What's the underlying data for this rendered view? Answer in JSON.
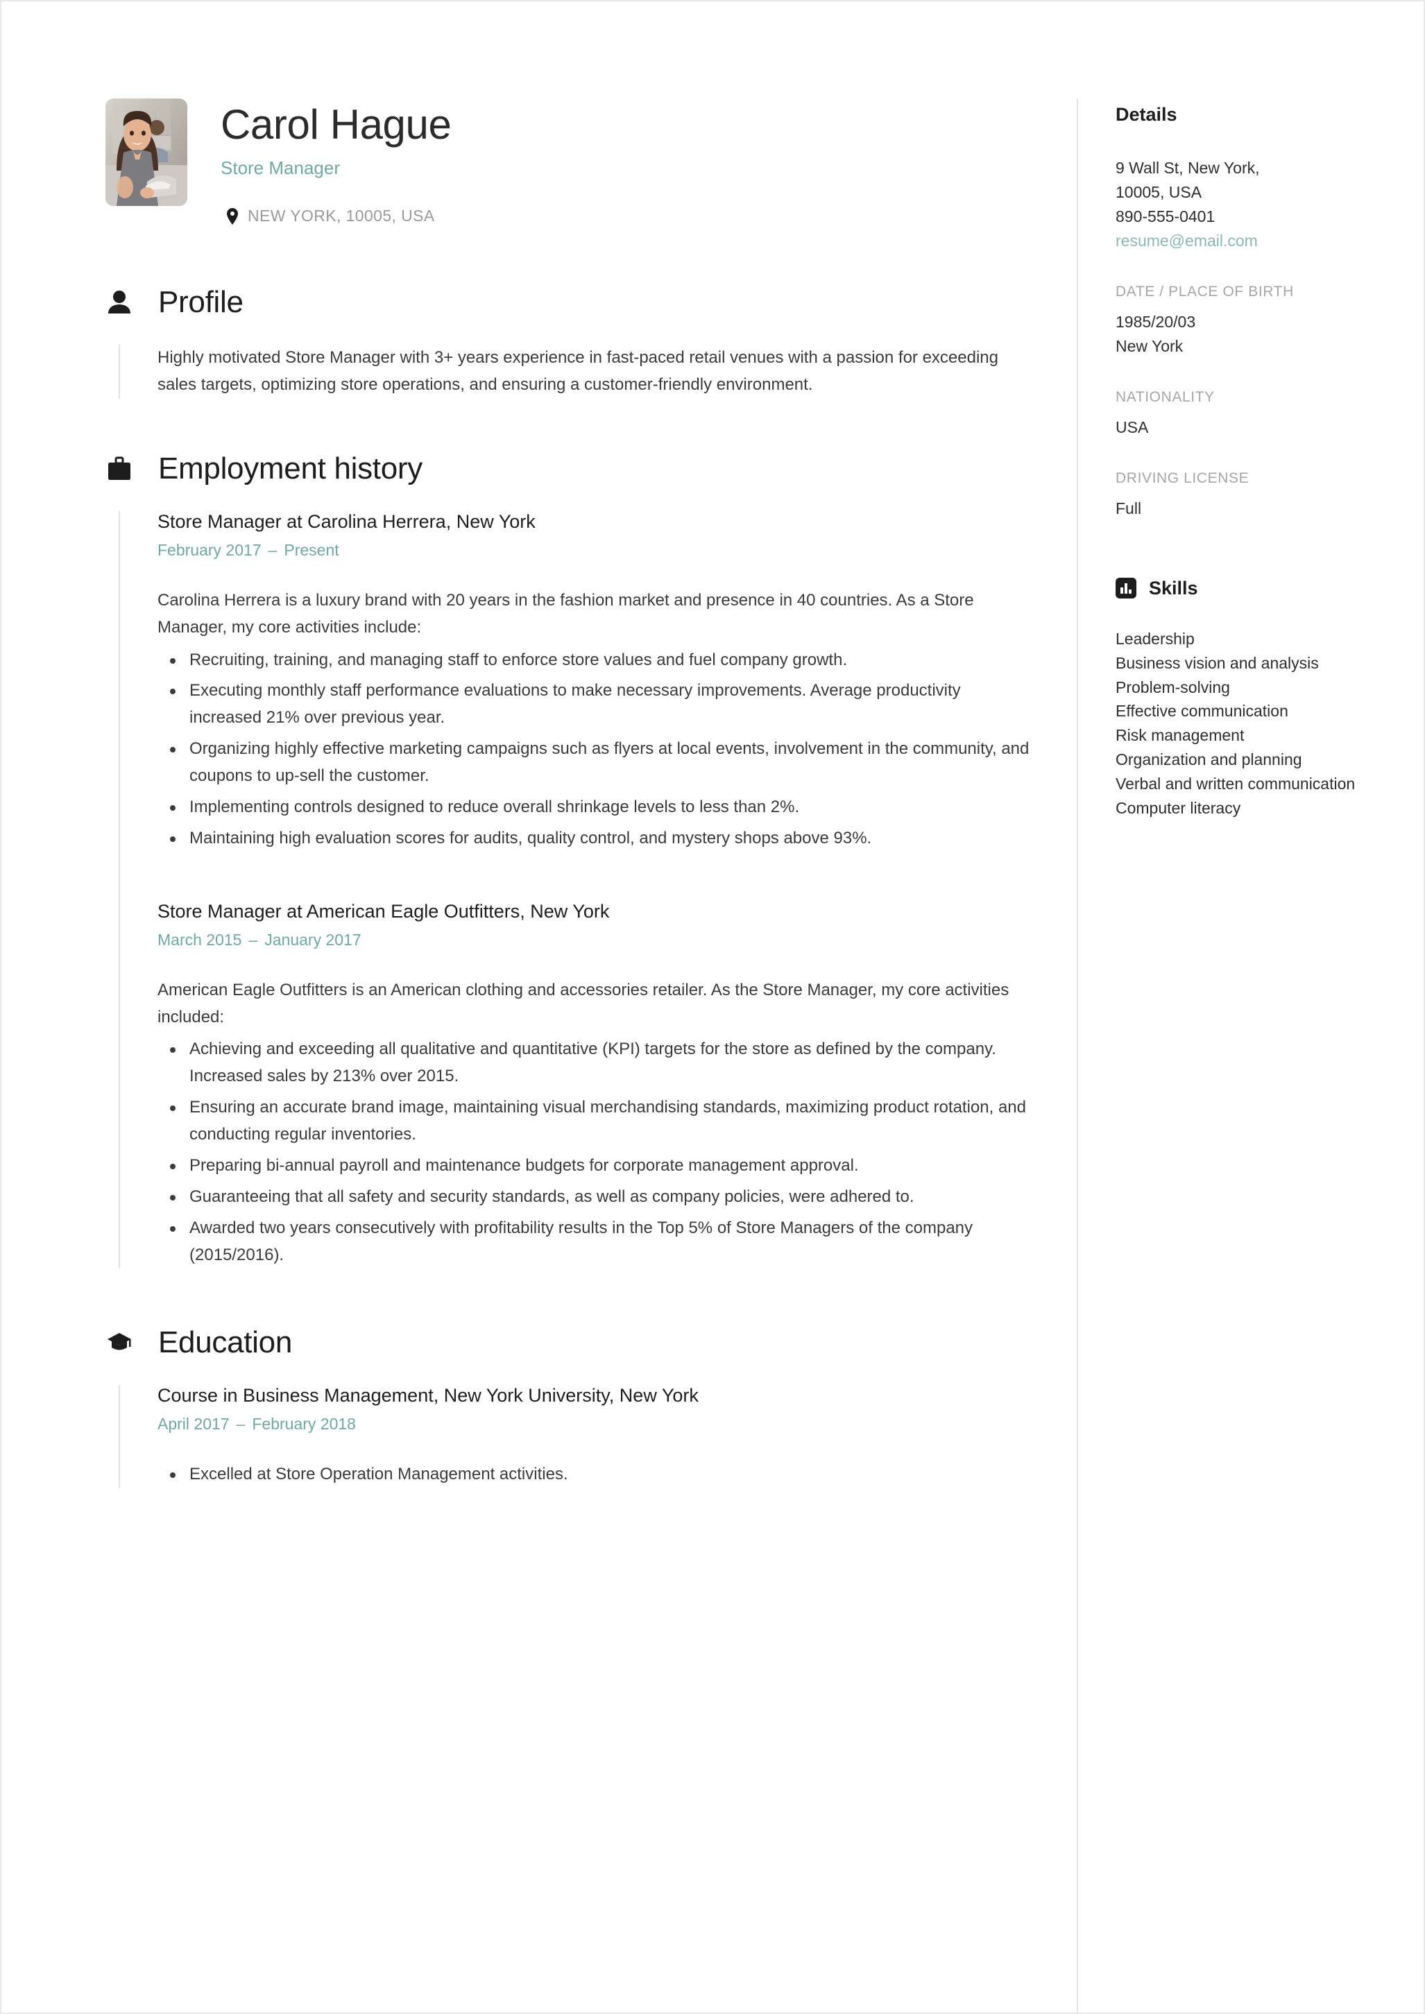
{
  "header": {
    "name": "Carol Hague",
    "role": "Store Manager",
    "location": "NEW YORK, 10005, USA",
    "location_icon": "map-pin-icon",
    "avatar_alt": "portrait-photo"
  },
  "accent_color": "#71a9a0",
  "label_color": "#a6a6a6",
  "text_color": "#3b3b3b",
  "sections": {
    "profile": {
      "icon": "person-icon",
      "title": "Profile",
      "text": "Highly motivated Store Manager with 3+ years experience in fast-paced retail venues with a passion for exceeding sales targets, optimizing store operations, and ensuring a customer-friendly environment."
    },
    "employment": {
      "icon": "briefcase-icon",
      "title": "Employment history",
      "entries": [
        {
          "title": "Store Manager at Carolina Herrera, New York",
          "date_start": "February 2017",
          "date_sep": "–",
          "date_end": "Present",
          "summary": "Carolina Herrera is a luxury brand with 20 years in the fashion market and presence in 40 countries. As a Store Manager, my core activities include:",
          "bullets": [
            "Recruiting, training, and managing staff to enforce store values and fuel company growth.",
            "Executing monthly staff performance evaluations to make necessary improvements. Average productivity increased 21% over previous year.",
            "Organizing highly effective marketing campaigns such as flyers at local events, involvement in the community, and coupons to up-sell the customer.",
            "Implementing controls designed to reduce overall shrinkage levels to less than 2%.",
            "Maintaining high evaluation scores for audits, quality control, and mystery shops above 93%."
          ]
        },
        {
          "title": "Store Manager at American Eagle Outfitters, New York",
          "date_start": "March 2015",
          "date_sep": "–",
          "date_end": "January 2017",
          "summary": "American Eagle Outfitters is an American clothing and accessories retailer. As the Store Manager, my core activities included:",
          "bullets": [
            "Achieving and exceeding all qualitative and quantitative (KPI) targets for the store as defined by the company. Increased sales by 213% over 2015.",
            "Ensuring an accurate brand image, maintaining visual merchandising standards, maximizing product rotation, and conducting regular inventories.",
            "Preparing bi-annual payroll and maintenance budgets for corporate management approval.",
            "Guaranteeing that all safety and security standards, as well as company policies, were adhered to.",
            "Awarded two years consecutively with profitability results in the Top 5% of Store Managers of the company (2015/2016)."
          ]
        }
      ]
    },
    "education": {
      "icon": "graduation-cap-icon",
      "title": "Education",
      "entries": [
        {
          "title": "Course in Business Management, New York University, New York",
          "date_start": "April 2017",
          "date_sep": "–",
          "date_end": "February 2018",
          "bullets": [
            "Excelled at Store Operation Management activities."
          ]
        }
      ]
    }
  },
  "sidebar": {
    "details_heading": "Details",
    "address_line1": "9 Wall St, New York,",
    "address_line2": "10005, USA",
    "phone": "890-555-0401",
    "email": "resume@email.com",
    "dob_label": "DATE / PLACE OF BIRTH",
    "dob_date": "1985/20/03",
    "dob_place": "New York",
    "nationality_label": "NATIONALITY",
    "nationality_value": "USA",
    "license_label": "DRIVING LICENSE",
    "license_value": "Full",
    "skills_icon": "bar-chart-icon",
    "skills_heading": "Skills",
    "skills": [
      "Leadership",
      "Business vision and analysis",
      "Problem-solving",
      "Effective communication",
      "Risk management",
      "Organization and planning",
      "Verbal and written communication",
      "Computer literacy"
    ]
  }
}
